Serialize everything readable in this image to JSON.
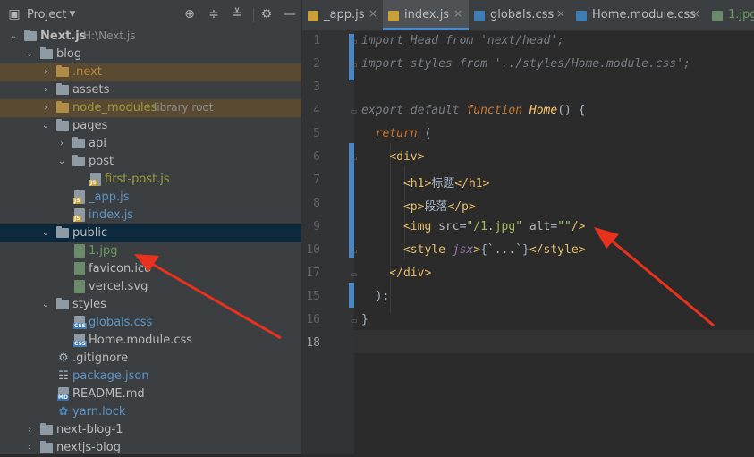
{
  "project_panel": {
    "title": "Project",
    "icons": [
      "locate-icon",
      "collapse-all-icon",
      "expand-all-icon",
      "settings-icon",
      "minimize-icon"
    ]
  },
  "tree": [
    {
      "label": "Next.js",
      "sublabel": "H:\\Next.js",
      "type": "root"
    },
    {
      "label": "blog",
      "type": "folder"
    },
    {
      "label": ".next",
      "type": "folder-excluded"
    },
    {
      "label": "assets",
      "type": "folder"
    },
    {
      "label": "node_modules",
      "sublabel": "library root",
      "type": "folder-excluded"
    },
    {
      "label": "pages",
      "type": "folder"
    },
    {
      "label": "api",
      "type": "folder"
    },
    {
      "label": "post",
      "type": "folder"
    },
    {
      "label": "first-post.js",
      "type": "js"
    },
    {
      "label": "_app.js",
      "type": "js"
    },
    {
      "label": "index.js",
      "type": "js"
    },
    {
      "label": "public",
      "type": "folder-selected"
    },
    {
      "label": "1.jpg",
      "type": "image"
    },
    {
      "label": "favicon.ico",
      "type": "image"
    },
    {
      "label": "vercel.svg",
      "type": "image"
    },
    {
      "label": "styles",
      "type": "folder"
    },
    {
      "label": "globals.css",
      "type": "css"
    },
    {
      "label": "Home.module.css",
      "type": "css"
    },
    {
      "label": ".gitignore",
      "type": "gitignore"
    },
    {
      "label": "package.json",
      "type": "json"
    },
    {
      "label": "README.md",
      "type": "md"
    },
    {
      "label": "yarn.lock",
      "type": "yarn"
    },
    {
      "label": "next-blog-1",
      "type": "folder"
    },
    {
      "label": "nextjs-blog",
      "type": "folder"
    }
  ],
  "tabs": [
    {
      "label": "_app.js",
      "type": "js",
      "active": false
    },
    {
      "label": "index.js",
      "type": "js",
      "active": true
    },
    {
      "label": "globals.css",
      "type": "css",
      "active": false
    },
    {
      "label": "Home.module.css",
      "type": "css",
      "active": false
    },
    {
      "label": "1.jpg",
      "type": "image",
      "active": false
    }
  ],
  "close_glyph": "×",
  "line_numbers": [
    "1",
    "2",
    "3",
    "4",
    "5",
    "6",
    "7",
    "8",
    "9",
    "10",
    "15",
    "16",
    "17",
    "18"
  ],
  "current_line": "18",
  "code": {
    "l1": {
      "kw": "import",
      "name": " Head ",
      "from": "from",
      "str": " 'next/head'",
      "semi": ";"
    },
    "l2": {
      "kw": "import",
      "name": " styles ",
      "from": "from",
      "str": " '../styles/Home.module.css'",
      "semi": ";"
    },
    "l4": {
      "kw1": "export",
      "kw2": " default ",
      "kw3": "function",
      "fn": " Home",
      "rest": "() {"
    },
    "l5": {
      "kw": "return",
      "rest": " ("
    },
    "l6": {
      "tag": "<div>"
    },
    "l7": {
      "open": "<h1>",
      "text": "标题",
      "close": "</h1>"
    },
    "l8": {
      "open": "<p>",
      "text": "段落",
      "close": "</p>"
    },
    "l9": {
      "open": "<img",
      "attr1": " src",
      "eq1": "=",
      "val1": "\"/1.jpg\"",
      "attr2": " alt",
      "eq2": "=",
      "val2": "\"\"",
      "end": "/>"
    },
    "l10": {
      "open": "<style",
      "attr": " jsx",
      "gt": ">",
      "brace": "{`...`}",
      "close": "</style>"
    },
    "l15": {
      "tag": "</div>"
    },
    "l16": {
      "text": ");"
    },
    "l17": {
      "text": "}"
    }
  },
  "colors": {
    "panel_bg": "#3c3f41",
    "editor_bg": "#2b2b2b",
    "selection": "#0d293e",
    "annotation_arrow": "#e8321e",
    "active_tab_underline": "#4a88c7"
  }
}
